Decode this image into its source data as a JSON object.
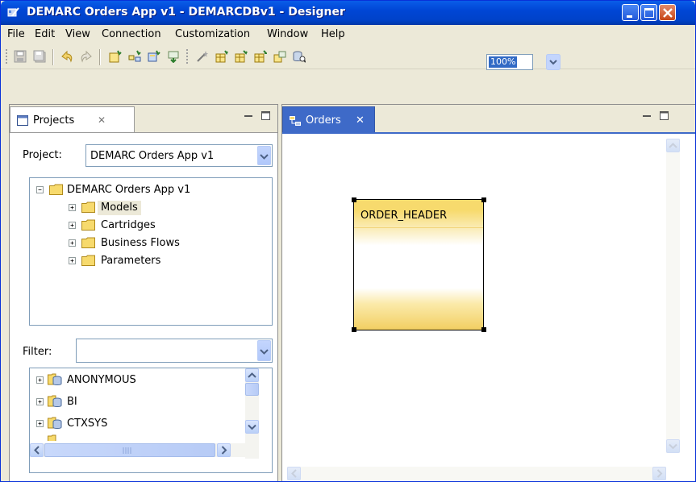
{
  "window": {
    "title": "DEMARC Orders App v1 - DEMARCDBv1 - Designer",
    "controls": {
      "minimize": "minimize",
      "maximize": "maximize",
      "close": "close"
    }
  },
  "menu": {
    "items": [
      "File",
      "Edit",
      "View",
      "Connection",
      "Customization",
      "Window",
      "Help"
    ]
  },
  "toolbar": {
    "zoom": "100%",
    "icons": [
      "save-icon",
      "save-all-icon",
      "undo-icon",
      "redo-icon",
      "new-model-icon",
      "new-diagram-icon",
      "new-entity-icon",
      "new-relation-icon",
      "magic-wand-icon",
      "table-add-icon",
      "table-import-icon",
      "table-export-icon",
      "table-link-icon",
      "database-search-icon"
    ]
  },
  "projects_panel": {
    "tab_label": "Projects",
    "tab_close": "✕",
    "project_label": "Project:",
    "project_value": "DEMARC Orders App v1",
    "tree": {
      "root": "DEMARC Orders App v1",
      "children": [
        "Models",
        "Cartridges",
        "Business Flows",
        "Parameters"
      ],
      "selected": "Models"
    },
    "filter_label": "Filter:",
    "filter_value": "",
    "schemas": [
      "ANONYMOUS",
      "BI",
      "CTXSYS"
    ]
  },
  "editor": {
    "tab_label": "Orders",
    "tab_close": "✕",
    "entity": {
      "name": "ORDER_HEADER"
    }
  },
  "colors": {
    "titlebar": "#0046D5",
    "entity_fill": "#F7DA6D",
    "selection": "#316AC5",
    "chrome": "#ECE9D8"
  }
}
